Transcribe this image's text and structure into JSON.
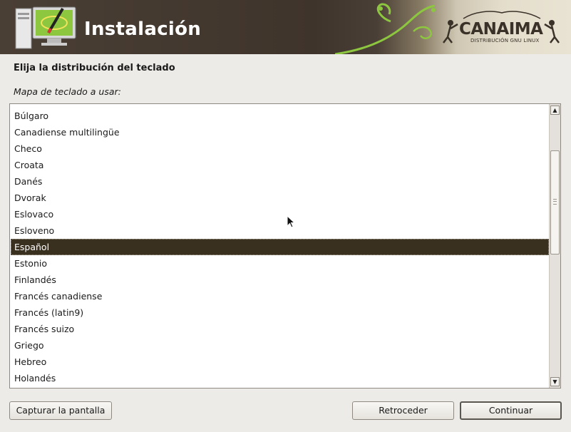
{
  "header": {
    "title": "Instalación",
    "brand": "CANAIMA",
    "brand_subtitle": "DISTRIBUCIÓN GNU LINUX",
    "colors": {
      "banner_dark": "#3f342b",
      "brand_green": "#8dc63f"
    }
  },
  "main": {
    "section_title": "Elija la distribución del teclado",
    "list_label": "Mapa de teclado a usar:",
    "selected_item": "Español",
    "items": [
      "Búlgaro",
      "Canadiense multilingüe",
      "Checo",
      "Croata",
      "Danés",
      "Dvorak",
      "Eslovaco",
      "Esloveno",
      "Español",
      "Estonio",
      "Finlandés",
      "Francés canadiense",
      "Francés (latin9)",
      "Francés suizo",
      "Griego",
      "Hebreo",
      "Holandés"
    ],
    "scrollbar": {
      "position_fraction": 0.22
    }
  },
  "footer": {
    "capture_label": "Capturar la pantalla",
    "back_label": "Retroceder",
    "continue_label": "Continuar"
  }
}
